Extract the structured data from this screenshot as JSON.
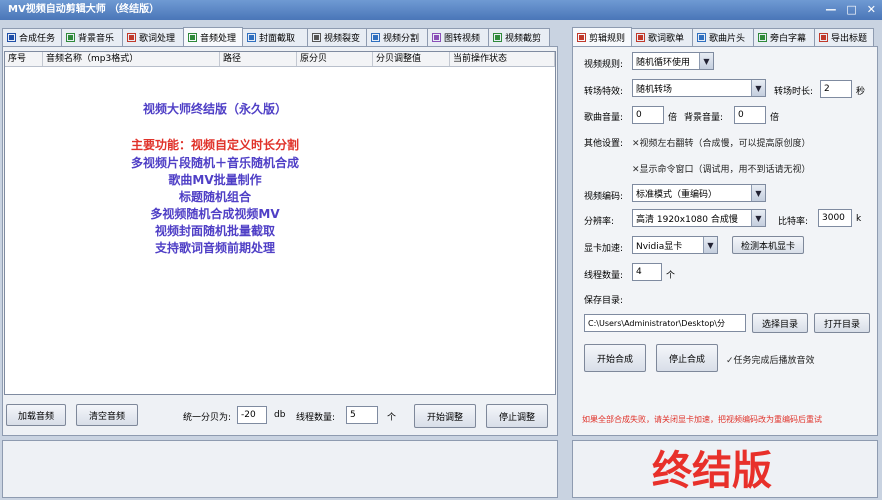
{
  "window": {
    "title": "MV视频自动剪辑大师 （终结版）",
    "minimize": "—",
    "maximize": "□",
    "close": "✕"
  },
  "tabs_left": [
    {
      "label": "合成任务",
      "icon": "play-icon",
      "color": "#1f4fa8"
    },
    {
      "label": "背景音乐",
      "icon": "music-icon",
      "color": "#2f8a3a"
    },
    {
      "label": "歌词处理",
      "icon": "lyrics-icon",
      "color": "#c0392b"
    },
    {
      "label": "音频处理",
      "icon": "audio-icon",
      "color": "#2f8a3a"
    },
    {
      "label": "封面截取",
      "icon": "image-icon",
      "color": "#2f6fbf"
    },
    {
      "label": "视频裂变",
      "icon": "video-icon",
      "color": "#555"
    },
    {
      "label": "视频分割",
      "icon": "split-icon",
      "color": "#2f6fbf"
    },
    {
      "label": "图转视频",
      "icon": "image-video-icon",
      "color": "#8a4fb8"
    },
    {
      "label": "视频截剪",
      "icon": "cut-icon",
      "color": "#2f8a3a"
    }
  ],
  "tabs_right": [
    {
      "label": "剪辑规则",
      "icon": "page-icon",
      "color": "#c0392b"
    },
    {
      "label": "歌词歌单",
      "icon": "font-icon",
      "color": "#c0392b"
    },
    {
      "label": "歌曲片头",
      "icon": "image-icon",
      "color": "#2f6fbf"
    },
    {
      "label": "旁白字幕",
      "icon": "subtitle-icon",
      "color": "#2f8a3a"
    },
    {
      "label": "导出标题",
      "icon": "export-icon",
      "color": "#c0392b"
    }
  ],
  "table": {
    "columns": [
      "序号",
      "音频名称（mp3格式）",
      "路径",
      "原分贝",
      "分贝调整值",
      "当前操作状态"
    ]
  },
  "promo": {
    "title": "视频大师终结版（永久版）",
    "features_heading": "主要功能：视频自定义时长分割",
    "features": [
      "多视频片段随机＋音乐随机合成",
      "歌曲MV批量制作",
      "标题随机组合",
      "多视频随机合成视频MV",
      "视频封面随机批量截取",
      "支持歌词音频前期处理"
    ]
  },
  "bottom_bar": {
    "load_audio": "加载音频",
    "clear_audio": "清空音频",
    "uniform_db_label": "统一分贝为:",
    "uniform_db_value": "-20",
    "db_unit": "db",
    "threads_label": "线程数量:",
    "threads_value": "5",
    "threads_unit": "个",
    "start_adjust": "开始调整",
    "stop_adjust": "停止调整"
  },
  "settings": {
    "video_rule_label": "视频规则:",
    "video_rule_value": "随机循环使用",
    "transition_label": "转场特效:",
    "transition_value": "随机转场",
    "transition_duration_label": "转场时长:",
    "transition_duration_value": "2",
    "seconds_unit": "秒",
    "song_volume_label": "歌曲音量:",
    "song_volume_value": "0",
    "times_unit": "倍",
    "bg_volume_label": "背景音量:",
    "bg_volume_value": "0",
    "other_label": "其他设置:",
    "option_flip": "视频左右翻转（合成慢，可以提高原创度）",
    "option_cmd": "显示命令窗口（调试用，用不到话请无视）",
    "encoder_label": "视频编码:",
    "encoder_value": "标准模式（重编码）",
    "resolution_label": "分辨率:",
    "resolution_value": "高清 1920x1080 合成慢",
    "bitrate_label": "比特率:",
    "bitrate_value": "3000",
    "bitrate_unit": "k",
    "gpu_label": "显卡加速:",
    "gpu_value": "Nvidia显卡",
    "detect_gpu": "检测本机显卡",
    "thread_label": "线程数量:",
    "thread_value": "4",
    "thread_unit": "个",
    "save_dir_label": "保存目录:",
    "save_dir_value": "C:\\Users\\Administrator\\Desktop\\分",
    "choose_dir": "选择目录",
    "open_dir": "打开目录",
    "start_compose": "开始合成",
    "stop_compose": "停止合成",
    "play_sound_label": "任务完成后播放音效",
    "warning": "如果全部合成失败，请关闭显卡加速，把视频编码改为重编码后重试"
  },
  "watermark": "终结版",
  "colors": {
    "promo_blue": "#4f3fc6",
    "promo_red": "#e0322a",
    "warning_red": "#e0322a",
    "watermark_red": "#e8302a"
  }
}
